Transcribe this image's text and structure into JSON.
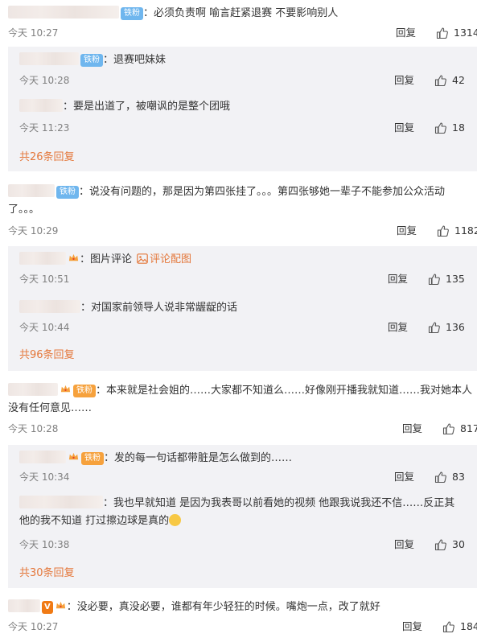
{
  "comments": [
    {
      "badge": "铁粉",
      "text": "：必须负责啊 喻言赶紧退赛 不要影响别人",
      "time": "今天 10:27",
      "reply": "回复",
      "likes": "1314",
      "subs": [
        {
          "badge": "铁粉",
          "text": "：退赛吧妹妹",
          "time": "今天 10:28",
          "reply": "回复",
          "likes": "42"
        },
        {
          "text": "：要是出道了，被嘲讽的是整个团哦",
          "time": "今天 11:23",
          "reply": "回复",
          "likes": "18"
        }
      ],
      "more": "共26条回复"
    },
    {
      "badge": "铁粉",
      "text_line1": "：说没有问题的，那是因为第四张挂了。。。第四张够她一辈子不能参加公众活动",
      "text_line2": "了。。。",
      "time": "今天 10:29",
      "reply": "回复",
      "likes": "1182",
      "subs": [
        {
          "text": "：图片评论",
          "pic_link": "评论配图",
          "time": "今天 10:51",
          "reply": "回复",
          "likes": "135"
        },
        {
          "text": "：对国家前领导人说非常龌龊的话",
          "time": "今天 10:44",
          "reply": "回复",
          "likes": "136"
        }
      ],
      "more": "共96条回复"
    },
    {
      "badge": "铁粉",
      "text_line1": "：本来就是社会姐的……大家都不知道么……好像刚开播我就知道……我对她本人",
      "text_line2": "没有任何意见……",
      "time": "今天 10:28",
      "reply": "回复",
      "likes": "817",
      "subs": [
        {
          "badge": "铁粉",
          "text": "：发的每一句话都带脏是怎么做到的……",
          "time": "今天 10:34",
          "reply": "回复",
          "likes": "83"
        },
        {
          "text_line1": "：我也早就知道 是因为我表哥以前看她的视频 他跟我说我还不信……反正其",
          "text_line2": "他的我不知道 打过擦边球是真的",
          "time": "今天 10:38",
          "reply": "回复",
          "likes": "30"
        }
      ],
      "more": "共30条回复"
    },
    {
      "badge": "V",
      "text": "：没必要，真没必要，谁都有年少轻狂的时候。嘴炮一点，改了就好",
      "time": "今天 10:27",
      "reply": "回复",
      "likes": "184"
    }
  ],
  "colors": {
    "accent": "#e4773a",
    "badge_blue": "#6fb6ee",
    "sub_bg": "#f2f2f5"
  },
  "icons": {
    "like": "thumbs-up-icon",
    "crown": "crown-icon",
    "picture": "picture-icon"
  }
}
